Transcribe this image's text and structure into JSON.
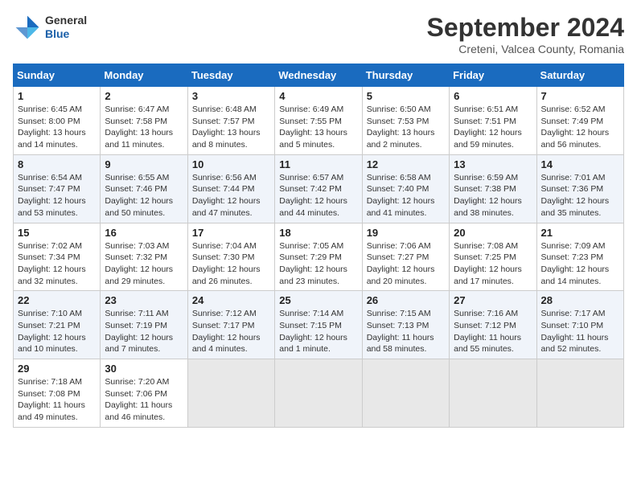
{
  "header": {
    "logo": {
      "general": "General",
      "blue": "Blue"
    },
    "title": "September 2024",
    "subtitle": "Creteni, Valcea County, Romania"
  },
  "calendar": {
    "days": [
      "Sunday",
      "Monday",
      "Tuesday",
      "Wednesday",
      "Thursday",
      "Friday",
      "Saturday"
    ],
    "weeks": [
      [
        {
          "num": "1",
          "lines": [
            "Sunrise: 6:45 AM",
            "Sunset: 8:00 PM",
            "Daylight: 13 hours",
            "and 14 minutes."
          ]
        },
        {
          "num": "2",
          "lines": [
            "Sunrise: 6:47 AM",
            "Sunset: 7:58 PM",
            "Daylight: 13 hours",
            "and 11 minutes."
          ]
        },
        {
          "num": "3",
          "lines": [
            "Sunrise: 6:48 AM",
            "Sunset: 7:57 PM",
            "Daylight: 13 hours",
            "and 8 minutes."
          ]
        },
        {
          "num": "4",
          "lines": [
            "Sunrise: 6:49 AM",
            "Sunset: 7:55 PM",
            "Daylight: 13 hours",
            "and 5 minutes."
          ]
        },
        {
          "num": "5",
          "lines": [
            "Sunrise: 6:50 AM",
            "Sunset: 7:53 PM",
            "Daylight: 13 hours",
            "and 2 minutes."
          ]
        },
        {
          "num": "6",
          "lines": [
            "Sunrise: 6:51 AM",
            "Sunset: 7:51 PM",
            "Daylight: 12 hours",
            "and 59 minutes."
          ]
        },
        {
          "num": "7",
          "lines": [
            "Sunrise: 6:52 AM",
            "Sunset: 7:49 PM",
            "Daylight: 12 hours",
            "and 56 minutes."
          ]
        }
      ],
      [
        {
          "num": "8",
          "lines": [
            "Sunrise: 6:54 AM",
            "Sunset: 7:47 PM",
            "Daylight: 12 hours",
            "and 53 minutes."
          ]
        },
        {
          "num": "9",
          "lines": [
            "Sunrise: 6:55 AM",
            "Sunset: 7:46 PM",
            "Daylight: 12 hours",
            "and 50 minutes."
          ]
        },
        {
          "num": "10",
          "lines": [
            "Sunrise: 6:56 AM",
            "Sunset: 7:44 PM",
            "Daylight: 12 hours",
            "and 47 minutes."
          ]
        },
        {
          "num": "11",
          "lines": [
            "Sunrise: 6:57 AM",
            "Sunset: 7:42 PM",
            "Daylight: 12 hours",
            "and 44 minutes."
          ]
        },
        {
          "num": "12",
          "lines": [
            "Sunrise: 6:58 AM",
            "Sunset: 7:40 PM",
            "Daylight: 12 hours",
            "and 41 minutes."
          ]
        },
        {
          "num": "13",
          "lines": [
            "Sunrise: 6:59 AM",
            "Sunset: 7:38 PM",
            "Daylight: 12 hours",
            "and 38 minutes."
          ]
        },
        {
          "num": "14",
          "lines": [
            "Sunrise: 7:01 AM",
            "Sunset: 7:36 PM",
            "Daylight: 12 hours",
            "and 35 minutes."
          ]
        }
      ],
      [
        {
          "num": "15",
          "lines": [
            "Sunrise: 7:02 AM",
            "Sunset: 7:34 PM",
            "Daylight: 12 hours",
            "and 32 minutes."
          ]
        },
        {
          "num": "16",
          "lines": [
            "Sunrise: 7:03 AM",
            "Sunset: 7:32 PM",
            "Daylight: 12 hours",
            "and 29 minutes."
          ]
        },
        {
          "num": "17",
          "lines": [
            "Sunrise: 7:04 AM",
            "Sunset: 7:30 PM",
            "Daylight: 12 hours",
            "and 26 minutes."
          ]
        },
        {
          "num": "18",
          "lines": [
            "Sunrise: 7:05 AM",
            "Sunset: 7:29 PM",
            "Daylight: 12 hours",
            "and 23 minutes."
          ]
        },
        {
          "num": "19",
          "lines": [
            "Sunrise: 7:06 AM",
            "Sunset: 7:27 PM",
            "Daylight: 12 hours",
            "and 20 minutes."
          ]
        },
        {
          "num": "20",
          "lines": [
            "Sunrise: 7:08 AM",
            "Sunset: 7:25 PM",
            "Daylight: 12 hours",
            "and 17 minutes."
          ]
        },
        {
          "num": "21",
          "lines": [
            "Sunrise: 7:09 AM",
            "Sunset: 7:23 PM",
            "Daylight: 12 hours",
            "and 14 minutes."
          ]
        }
      ],
      [
        {
          "num": "22",
          "lines": [
            "Sunrise: 7:10 AM",
            "Sunset: 7:21 PM",
            "Daylight: 12 hours",
            "and 10 minutes."
          ]
        },
        {
          "num": "23",
          "lines": [
            "Sunrise: 7:11 AM",
            "Sunset: 7:19 PM",
            "Daylight: 12 hours",
            "and 7 minutes."
          ]
        },
        {
          "num": "24",
          "lines": [
            "Sunrise: 7:12 AM",
            "Sunset: 7:17 PM",
            "Daylight: 12 hours",
            "and 4 minutes."
          ]
        },
        {
          "num": "25",
          "lines": [
            "Sunrise: 7:14 AM",
            "Sunset: 7:15 PM",
            "Daylight: 12 hours",
            "and 1 minute."
          ]
        },
        {
          "num": "26",
          "lines": [
            "Sunrise: 7:15 AM",
            "Sunset: 7:13 PM",
            "Daylight: 11 hours",
            "and 58 minutes."
          ]
        },
        {
          "num": "27",
          "lines": [
            "Sunrise: 7:16 AM",
            "Sunset: 7:12 PM",
            "Daylight: 11 hours",
            "and 55 minutes."
          ]
        },
        {
          "num": "28",
          "lines": [
            "Sunrise: 7:17 AM",
            "Sunset: 7:10 PM",
            "Daylight: 11 hours",
            "and 52 minutes."
          ]
        }
      ],
      [
        {
          "num": "29",
          "lines": [
            "Sunrise: 7:18 AM",
            "Sunset: 7:08 PM",
            "Daylight: 11 hours",
            "and 49 minutes."
          ]
        },
        {
          "num": "30",
          "lines": [
            "Sunrise: 7:20 AM",
            "Sunset: 7:06 PM",
            "Daylight: 11 hours",
            "and 46 minutes."
          ]
        },
        {
          "num": "",
          "lines": []
        },
        {
          "num": "",
          "lines": []
        },
        {
          "num": "",
          "lines": []
        },
        {
          "num": "",
          "lines": []
        },
        {
          "num": "",
          "lines": []
        }
      ]
    ]
  }
}
